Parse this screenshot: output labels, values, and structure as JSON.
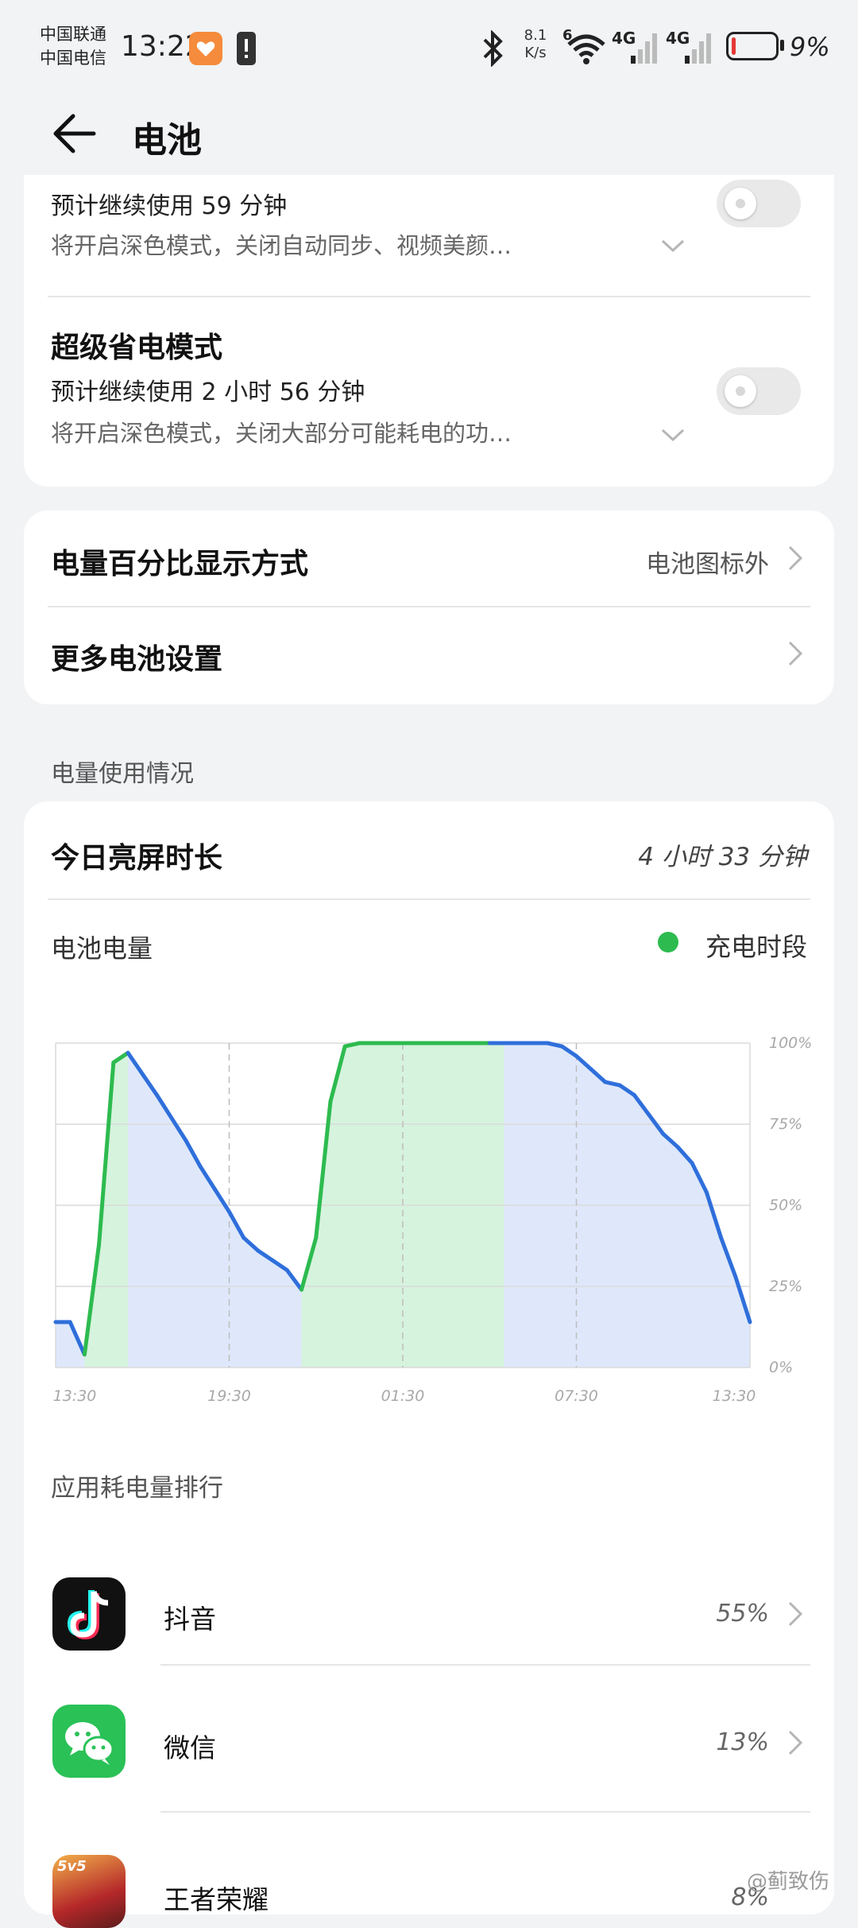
{
  "status_bar": {
    "carrier1": "中国联通",
    "carrier2": "中国电信",
    "time": "13:22",
    "net_speed_top": "8.1",
    "net_speed_unit": "K/s",
    "wifi_label": "6",
    "sig1": "4G",
    "sig2": "4G",
    "battery": "9%",
    "battery_level": 0.09
  },
  "header": {
    "title": "电池"
  },
  "power_modes": [
    {
      "sub": "预计继续使用 59 分钟",
      "desc": "将开启深色模式，关闭自动同步、视频美颜…",
      "enabled": false
    },
    {
      "title": "超级省电模式",
      "sub": "预计继续使用 2 小时 56 分钟",
      "desc": "将开启深色模式，关闭大部分可能耗电的功…",
      "enabled": false
    }
  ],
  "settings": {
    "percent_display_label": "电量百分比显示方式",
    "percent_display_value": "电池图标外",
    "more_settings_label": "更多电池设置"
  },
  "usage_section_label": "电量使用情况",
  "screen_time": {
    "label": "今日亮屏时长",
    "value": "4 小时 33 分钟"
  },
  "battery_chart": {
    "label": "电池电量",
    "legend_charging": "充电时段",
    "colors": {
      "line_discharge": "#2f6fdb",
      "line_charge": "#2dbb4f",
      "fill_discharge": "#dfe8fb",
      "fill_charge": "#d6f3dd"
    }
  },
  "chart_data": {
    "type": "line",
    "x_tick_labels": [
      "13:30",
      "19:30",
      "01:30",
      "07:30",
      "13:30"
    ],
    "y_tick_labels": [
      "100%",
      "75%",
      "50%",
      "25%",
      "0%"
    ],
    "ylim": [
      0,
      100
    ],
    "xlim_hours": [
      0,
      24
    ],
    "series": [
      {
        "points_hours_pct": [
          [
            0,
            14
          ],
          [
            0.5,
            14
          ],
          [
            1.0,
            4
          ],
          [
            1.5,
            38
          ],
          [
            2.0,
            94
          ],
          [
            2.5,
            97
          ],
          [
            3.5,
            84
          ],
          [
            4.0,
            77
          ],
          [
            4.5,
            70
          ],
          [
            5.0,
            62
          ],
          [
            5.5,
            55
          ],
          [
            6.0,
            48
          ],
          [
            6.5,
            40
          ],
          [
            7.0,
            36
          ],
          [
            7.5,
            33
          ],
          [
            8.0,
            30
          ],
          [
            8.5,
            24
          ],
          [
            9.0,
            40
          ],
          [
            9.5,
            82
          ],
          [
            10.0,
            99
          ],
          [
            10.5,
            100
          ],
          [
            15.0,
            100
          ],
          [
            17.0,
            100
          ],
          [
            17.5,
            99
          ],
          [
            18.0,
            96
          ],
          [
            18.5,
            92
          ],
          [
            19.0,
            88
          ],
          [
            19.5,
            87
          ],
          [
            20.0,
            84
          ],
          [
            20.5,
            78
          ],
          [
            21.0,
            72
          ],
          [
            21.5,
            68
          ],
          [
            22.0,
            63
          ],
          [
            22.5,
            54
          ],
          [
            23.0,
            40
          ],
          [
            23.5,
            28
          ],
          [
            24.0,
            14
          ]
        ]
      }
    ],
    "charging_periods_hours": [
      [
        1.0,
        2.5
      ],
      [
        8.5,
        15.5
      ]
    ],
    "grid": true
  },
  "app_ranking": {
    "label": "应用耗电量排行",
    "apps": [
      {
        "name": "抖音",
        "percent": "55%",
        "icon": "douyin-icon"
      },
      {
        "name": "微信",
        "percent": "13%",
        "icon": "wechat-icon"
      },
      {
        "name": "王者荣耀",
        "percent": "8%",
        "icon": "honor-of-kings-icon"
      }
    ]
  },
  "watermark": "@蓟致伤"
}
